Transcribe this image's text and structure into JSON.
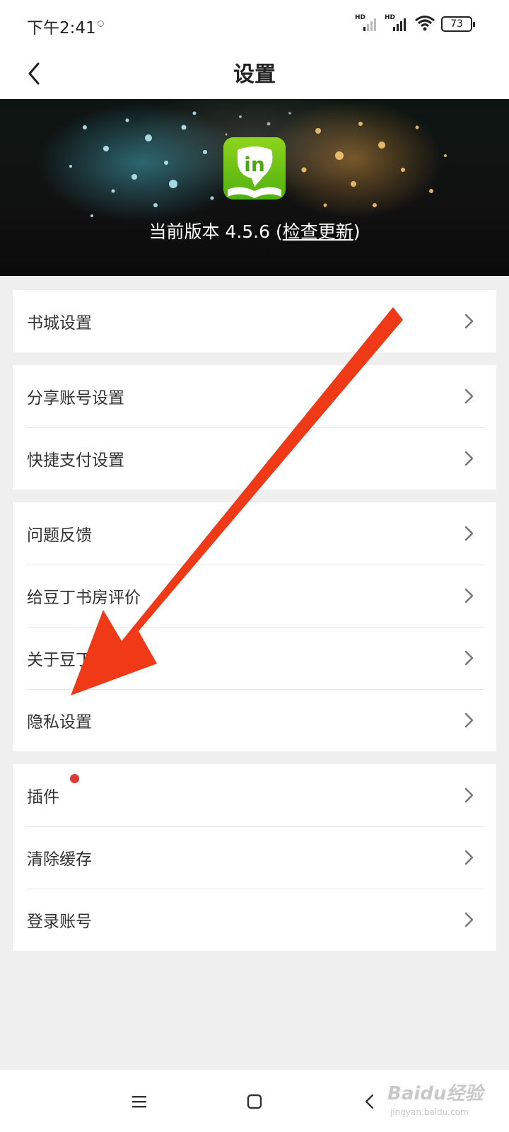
{
  "status_bar": {
    "time": "下午2:41",
    "signal_1_label": "HD",
    "signal_2_label": "HD",
    "battery": "73"
  },
  "header": {
    "title": "设置",
    "back_icon": "chevron-left-icon"
  },
  "banner": {
    "logo_text": "in",
    "version_prefix": "当前版本 4.5.6 (",
    "check_update": "检查更新",
    "version_suffix": ")"
  },
  "groups": [
    {
      "items": [
        {
          "label": "书城设置"
        }
      ]
    },
    {
      "items": [
        {
          "label": "分享账号设置"
        },
        {
          "label": "快捷支付设置"
        }
      ]
    },
    {
      "items": [
        {
          "label": "问题反馈"
        },
        {
          "label": "给豆丁书房评价"
        },
        {
          "label": "关于豆丁书房"
        },
        {
          "label": "隐私设置"
        }
      ]
    },
    {
      "items": [
        {
          "label": "插件",
          "badge": "red-dot"
        },
        {
          "label": "清除缓存"
        },
        {
          "label": "登录账号"
        }
      ]
    }
  ],
  "annotation": {
    "arrow_color": "#f03a17",
    "target": "隐私设置"
  },
  "bottom_nav": {
    "menu_icon": "menu-icon",
    "home_icon": "home-icon",
    "back_icon": "back-icon"
  },
  "watermark": {
    "main": "Baidu经验",
    "sub": "jingyan.baidu.com"
  }
}
